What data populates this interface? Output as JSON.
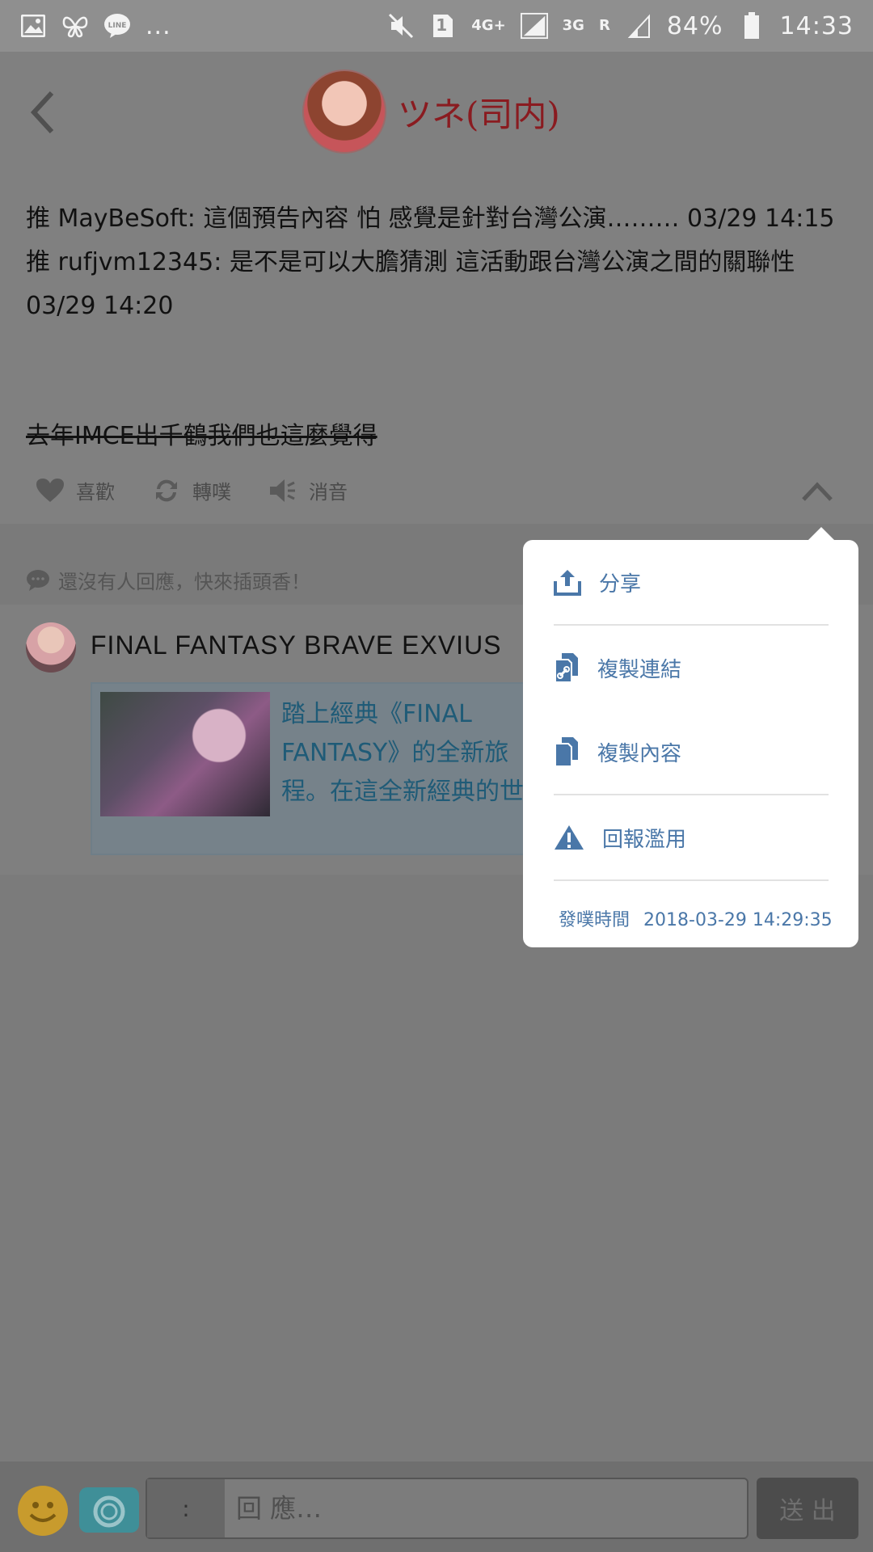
{
  "status_bar": {
    "icons_left": [
      "image-icon",
      "butterfly-icon",
      "line-app-icon"
    ],
    "more": "...",
    "sim": "1",
    "network_4g": "4G+",
    "network_3g": "3G",
    "roaming": "R",
    "battery": "84%",
    "time": "14:33"
  },
  "header": {
    "username": "ツネ(司内)"
  },
  "post": {
    "line1": "推 MayBeSoft: 這個預告內容 怕 感覺是針對台灣公演……… 03/29 14:15",
    "line2": "推 rufjvm12345: 是不是可以大膽猜測 這活動跟台灣公演之間的關聯性 03/29 14:20",
    "strike": "去年IMCE出千鶴我們也這麼覺得"
  },
  "actions": {
    "like": "喜歡",
    "replurk": "轉噗",
    "mute": "消音"
  },
  "noreply": "還沒有人回應，快來插頭香！",
  "ad": {
    "title": "FINAL FANTASY BRAVE EXVIUS",
    "text": "踏上經典《FINAL FANTASY》的全新旅程。在這全新經典的世界中，召集各路英雄們！"
  },
  "popup": {
    "share": "分享",
    "copy_link": "複製連結",
    "copy_content": "複製內容",
    "report": "回報濫用",
    "time_label": "發噗時間",
    "time_value": "2018-03-29 14:29:35"
  },
  "input": {
    "prefix": ":",
    "placeholder": "回 應…",
    "send": "送 出"
  },
  "colors": {
    "accent": "#4a77a8",
    "username": "#8a1b20"
  }
}
